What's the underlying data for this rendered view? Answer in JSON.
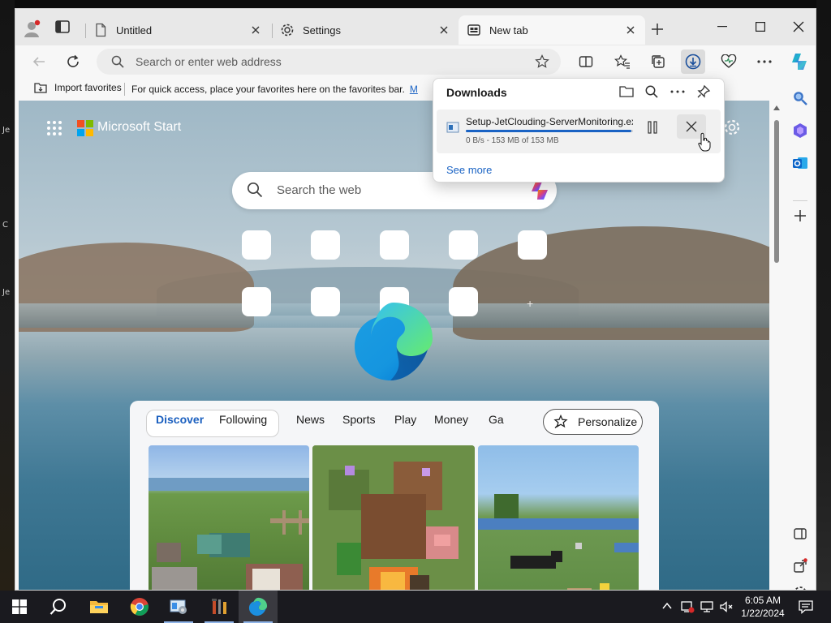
{
  "desktop": {
    "labels": [
      "Je",
      "C",
      "Je"
    ]
  },
  "tabs": [
    {
      "label": "Untitled",
      "icon": "page-icon"
    },
    {
      "label": "Settings",
      "icon": "gear-icon"
    },
    {
      "label": "New tab",
      "icon": "newtab-icon",
      "active": true
    }
  ],
  "address_bar": {
    "placeholder": "Search or enter web address"
  },
  "favorites_bar": {
    "import_label": "Import favorites",
    "hint_text": "For quick access, place your favorites here on the favorites bar.",
    "hint_link": "M"
  },
  "start_page": {
    "brand": "Microsoft Start",
    "search_placeholder": "Search the web",
    "feed_tabs": [
      "Discover",
      "Following",
      "News",
      "Sports",
      "Play",
      "Money",
      "Ga"
    ],
    "active_feed_tab": "Discover",
    "personalize_label": "Personalize"
  },
  "downloads": {
    "title": "Downloads",
    "file_name": "Setup-JetClouding-ServerMonitoring.exe",
    "status": "0 B/s - 153 MB of 153 MB",
    "progress": 0.99,
    "see_more": "See more"
  },
  "taskbar": {
    "time": "6:05 AM",
    "date": "1/22/2024"
  },
  "colors": {
    "accent": "#1a63c4",
    "feed_active": "#1a5fbf",
    "taskbar": "#1a1a1f"
  }
}
